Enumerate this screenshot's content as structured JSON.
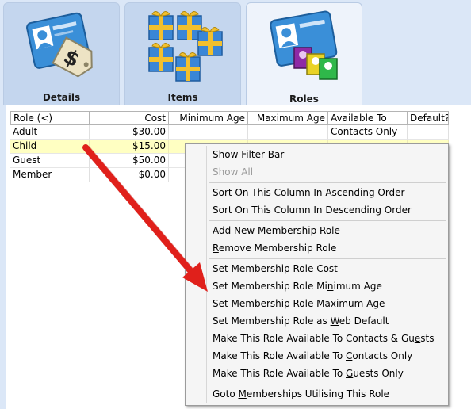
{
  "tabs": [
    {
      "label": "Details",
      "icon": "member-card-price-tag-icon"
    },
    {
      "label": "Items",
      "icon": "gift-boxes-icon"
    },
    {
      "label": "Roles",
      "icon": "member-card-people-icon"
    }
  ],
  "grid": {
    "columns": [
      "Role (<)",
      "Cost",
      "Minimum Age",
      "Maximum Age",
      "Available To",
      "Default?"
    ],
    "rows": [
      {
        "role": "Adult",
        "cost": "$30.00",
        "min_age": "",
        "max_age": "",
        "available_to": "Contacts Only",
        "default": ""
      },
      {
        "role": "Child",
        "cost": "$15.00",
        "min_age": "",
        "max_age": "",
        "available_to": "",
        "default": ""
      },
      {
        "role": "Guest",
        "cost": "$50.00",
        "min_age": "",
        "max_age": "",
        "available_to": "",
        "default": ""
      },
      {
        "role": "Member",
        "cost": "$0.00",
        "min_age": "",
        "max_age": "",
        "available_to": "",
        "default": ""
      }
    ],
    "selected_row": "Child"
  },
  "context_menu": {
    "items": [
      {
        "pre": "Show Filter Bar",
        "u": "",
        "post": "",
        "disabled": false
      },
      {
        "pre": "Show All",
        "u": "",
        "post": "",
        "disabled": true
      },
      {
        "pre": "Sort On This Column In Ascending Order",
        "u": "",
        "post": "",
        "disabled": false
      },
      {
        "pre": "Sort On This Column In Descending Order",
        "u": "",
        "post": "",
        "disabled": false
      },
      {
        "pre": "",
        "u": "A",
        "post": "dd New Membership Role",
        "disabled": false
      },
      {
        "pre": "",
        "u": "R",
        "post": "emove Membership Role",
        "disabled": false
      },
      {
        "pre": "Set Membership Role ",
        "u": "C",
        "post": "ost",
        "disabled": false
      },
      {
        "pre": "Set Membership Role Mi",
        "u": "n",
        "post": "imum Age",
        "disabled": false
      },
      {
        "pre": "Set Membership Role Ma",
        "u": "x",
        "post": "imum Age",
        "disabled": false
      },
      {
        "pre": "Set Membership Role as ",
        "u": "W",
        "post": "eb Default",
        "disabled": false
      },
      {
        "pre": "Make This Role Available To Contacts & Gu",
        "u": "e",
        "post": "sts",
        "disabled": false
      },
      {
        "pre": "Make This Role Available To ",
        "u": "C",
        "post": "ontacts Only",
        "disabled": false
      },
      {
        "pre": "Make This Role Available To ",
        "u": "G",
        "post": "uests Only",
        "disabled": false
      },
      {
        "pre": "Goto ",
        "u": "M",
        "post": "emberships Utilising This Role",
        "disabled": false
      }
    ]
  },
  "colors": {
    "background": "#dbe7f7",
    "tab_inactive": "#c4d6ee",
    "tab_active": "#eef3fb",
    "selected_row": "#ffffc2",
    "arrow": "#e0201b"
  }
}
